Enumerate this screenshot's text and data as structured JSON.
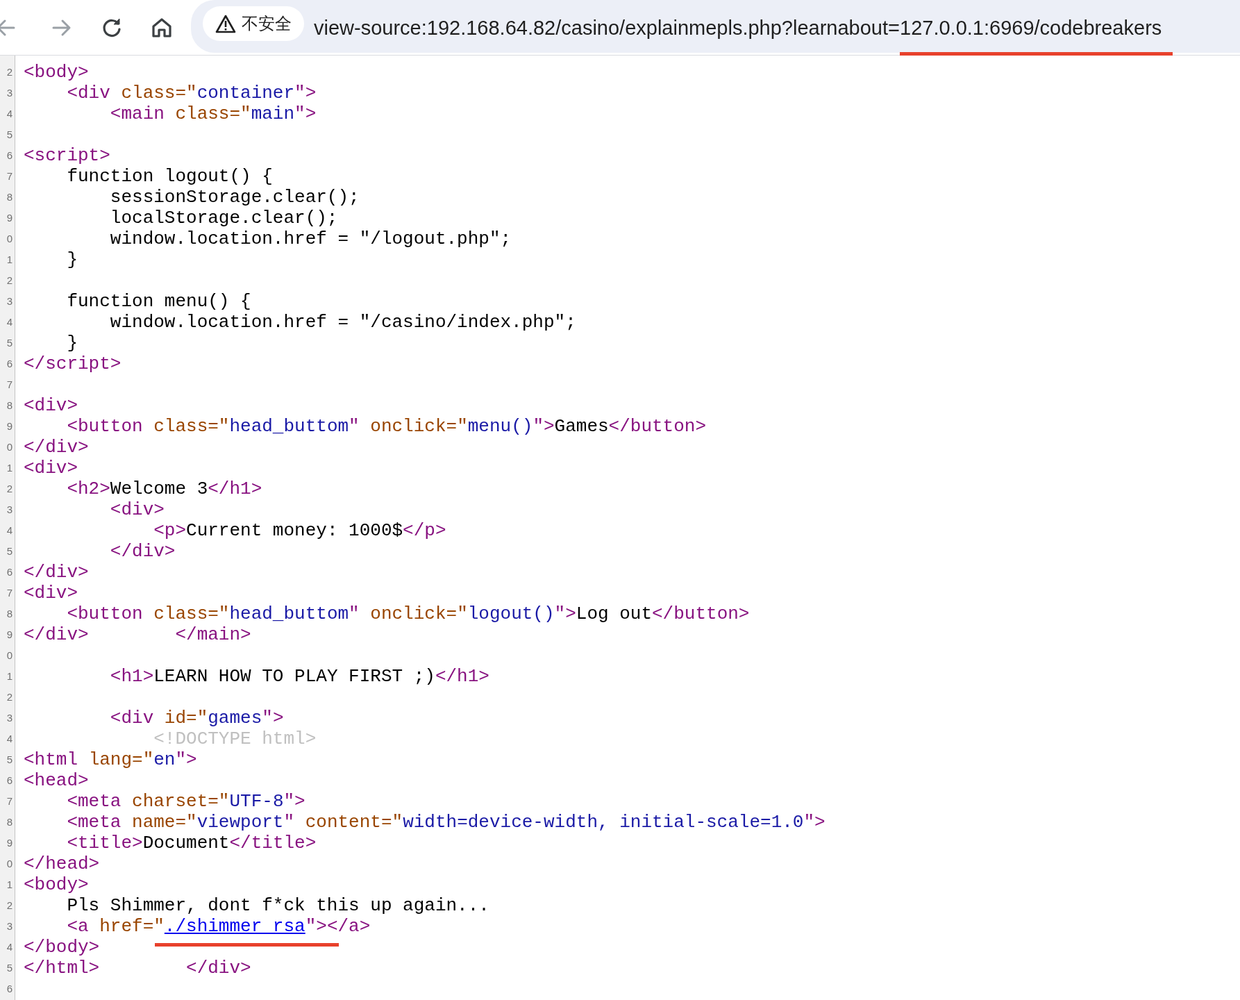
{
  "toolbar": {
    "buttons": [
      {
        "kind": "back",
        "disabled": true
      },
      {
        "kind": "forward",
        "disabled": true
      },
      {
        "kind": "reload",
        "disabled": false
      },
      {
        "kind": "home",
        "disabled": false
      }
    ]
  },
  "address_bar": {
    "security_label": "不安全",
    "url_parts": [
      {
        "text": "view-source:192.168.64.82/casino/explainmepls.php?learnabout=",
        "marked": false
      },
      {
        "text": "127.0.0.1:6969/codebreakers",
        "marked": true
      }
    ]
  },
  "source_lines": [
    {
      "number": "2",
      "tokens": [
        {
          "kind": "tag",
          "t": "<body>"
        }
      ]
    },
    {
      "number": "3",
      "tokens": [
        {
          "kind": "tag",
          "t": "    <div "
        },
        {
          "kind": "attr",
          "t": "class=\""
        },
        {
          "kind": "value",
          "t": "container"
        },
        {
          "kind": "tag",
          "t": "\">"
        }
      ]
    },
    {
      "number": "4",
      "tokens": [
        {
          "kind": "tag",
          "t": "        <main "
        },
        {
          "kind": "attr",
          "t": "class=\""
        },
        {
          "kind": "value",
          "t": "main"
        },
        {
          "kind": "tag",
          "t": "\">"
        }
      ]
    },
    {
      "number": "5"
    },
    {
      "number": "6",
      "tokens": [
        {
          "kind": "tag",
          "t": "<script>"
        }
      ]
    },
    {
      "number": "7",
      "tokens": [
        {
          "kind": "text",
          "t": "    function logout() {"
        }
      ]
    },
    {
      "number": "8",
      "tokens": [
        {
          "kind": "text",
          "t": "        sessionStorage.clear();"
        }
      ]
    },
    {
      "number": "9",
      "tokens": [
        {
          "kind": "text",
          "t": "        localStorage.clear();"
        }
      ]
    },
    {
      "number": "0",
      "tokens": [
        {
          "kind": "text",
          "t": "        window.location.href = \"/logout.php\";"
        }
      ]
    },
    {
      "number": "1",
      "tokens": [
        {
          "kind": "text",
          "t": "    }"
        }
      ]
    },
    {
      "number": "2"
    },
    {
      "number": "3",
      "tokens": [
        {
          "kind": "text",
          "t": "    function menu() {"
        }
      ]
    },
    {
      "number": "4",
      "tokens": [
        {
          "kind": "text",
          "t": "        window.location.href = \"/casino/index.php\";"
        }
      ]
    },
    {
      "number": "5",
      "tokens": [
        {
          "kind": "text",
          "t": "    }"
        }
      ]
    },
    {
      "number": "6",
      "tokens": [
        {
          "kind": "tag",
          "t": "</script>"
        }
      ]
    },
    {
      "number": "7"
    },
    {
      "number": "8",
      "tokens": [
        {
          "kind": "tag",
          "t": "<div>"
        }
      ]
    },
    {
      "number": "9",
      "tokens": [
        {
          "kind": "tag",
          "t": "    <button "
        },
        {
          "kind": "attr",
          "t": "class=\""
        },
        {
          "kind": "value",
          "t": "head_buttom"
        },
        {
          "kind": "tag",
          "t": "\" "
        },
        {
          "kind": "attr",
          "t": "onclick=\""
        },
        {
          "kind": "value",
          "t": "menu()"
        },
        {
          "kind": "tag",
          "t": "\">"
        },
        {
          "kind": "text",
          "t": "Games"
        },
        {
          "kind": "tag",
          "t": "</button>"
        }
      ]
    },
    {
      "number": "0",
      "tokens": [
        {
          "kind": "tag",
          "t": "</div>"
        }
      ]
    },
    {
      "number": "1",
      "tokens": [
        {
          "kind": "tag",
          "t": "<div>"
        }
      ]
    },
    {
      "number": "2",
      "tokens": [
        {
          "kind": "tag",
          "t": "    <h2>"
        },
        {
          "kind": "text",
          "t": "Welcome 3"
        },
        {
          "kind": "tag",
          "t": "</h1>"
        }
      ]
    },
    {
      "number": "3",
      "tokens": [
        {
          "kind": "tag",
          "t": "        <div>"
        }
      ]
    },
    {
      "number": "4",
      "tokens": [
        {
          "kind": "tag",
          "t": "            <p>"
        },
        {
          "kind": "text",
          "t": "Current money: 1000$"
        },
        {
          "kind": "tag",
          "t": "</p>"
        }
      ]
    },
    {
      "number": "5",
      "tokens": [
        {
          "kind": "tag",
          "t": "        </div>"
        }
      ]
    },
    {
      "number": "6",
      "tokens": [
        {
          "kind": "tag",
          "t": "</div>"
        }
      ]
    },
    {
      "number": "7",
      "tokens": [
        {
          "kind": "tag",
          "t": "<div>"
        }
      ]
    },
    {
      "number": "8",
      "tokens": [
        {
          "kind": "tag",
          "t": "    <button "
        },
        {
          "kind": "attr",
          "t": "class=\""
        },
        {
          "kind": "value",
          "t": "head_buttom"
        },
        {
          "kind": "tag",
          "t": "\" "
        },
        {
          "kind": "attr",
          "t": "onclick=\""
        },
        {
          "kind": "value",
          "t": "logout()"
        },
        {
          "kind": "tag",
          "t": "\">"
        },
        {
          "kind": "text",
          "t": "Log out"
        },
        {
          "kind": "tag",
          "t": "</button>"
        }
      ]
    },
    {
      "number": "9",
      "tokens": [
        {
          "kind": "tag",
          "t": "</div>        </main>"
        }
      ]
    },
    {
      "number": "0"
    },
    {
      "number": "1",
      "tokens": [
        {
          "kind": "tag",
          "t": "        <h1>"
        },
        {
          "kind": "text",
          "t": "LEARN HOW TO PLAY FIRST ;)"
        },
        {
          "kind": "tag",
          "t": "</h1>"
        }
      ]
    },
    {
      "number": "2"
    },
    {
      "number": "3",
      "tokens": [
        {
          "kind": "tag",
          "t": "        <div "
        },
        {
          "kind": "attr",
          "t": "id=\""
        },
        {
          "kind": "value",
          "t": "games"
        },
        {
          "kind": "tag",
          "t": "\">"
        }
      ]
    },
    {
      "number": "4",
      "tokens": [
        {
          "kind": "doctype",
          "t": "            <!DOCTYPE html>"
        }
      ]
    },
    {
      "number": "5",
      "tokens": [
        {
          "kind": "tag",
          "t": "<html "
        },
        {
          "kind": "attr",
          "t": "lang=\""
        },
        {
          "kind": "value",
          "t": "en"
        },
        {
          "kind": "tag",
          "t": "\">"
        }
      ]
    },
    {
      "number": "6",
      "tokens": [
        {
          "kind": "tag",
          "t": "<head>"
        }
      ]
    },
    {
      "number": "7",
      "tokens": [
        {
          "kind": "tag",
          "t": "    <meta "
        },
        {
          "kind": "attr",
          "t": "charset=\""
        },
        {
          "kind": "value",
          "t": "UTF-8"
        },
        {
          "kind": "tag",
          "t": "\">"
        }
      ]
    },
    {
      "number": "8",
      "tokens": [
        {
          "kind": "tag",
          "t": "    <meta "
        },
        {
          "kind": "attr",
          "t": "name=\""
        },
        {
          "kind": "value",
          "t": "viewport"
        },
        {
          "kind": "tag",
          "t": "\" "
        },
        {
          "kind": "attr",
          "t": "content=\""
        },
        {
          "kind": "value",
          "t": "width=device-width, initial-scale=1.0"
        },
        {
          "kind": "tag",
          "t": "\">"
        }
      ]
    },
    {
      "number": "9",
      "tokens": [
        {
          "kind": "tag",
          "t": "    <title>"
        },
        {
          "kind": "text",
          "t": "Document"
        },
        {
          "kind": "tag",
          "t": "</title>"
        }
      ]
    },
    {
      "number": "0",
      "tokens": [
        {
          "kind": "tag",
          "t": "</head>"
        }
      ]
    },
    {
      "number": "1",
      "tokens": [
        {
          "kind": "tag",
          "t": "<body>"
        }
      ]
    },
    {
      "number": "2",
      "tokens": [
        {
          "kind": "text",
          "t": "    Pls Shimmer, dont f*ck this up again..."
        }
      ]
    },
    {
      "number": "3",
      "tokens": [
        {
          "kind": "tag",
          "t": "    <a "
        },
        {
          "kind": "attr",
          "t": "href=\""
        },
        {
          "kind": "link",
          "t": "./shimmer_rsa",
          "marked": true
        },
        {
          "kind": "tag",
          "t": "\"></a>"
        }
      ]
    },
    {
      "number": "4",
      "tokens": [
        {
          "kind": "tag",
          "t": "</body>"
        }
      ]
    },
    {
      "number": "5",
      "tokens": [
        {
          "kind": "tag",
          "t": "</html>        </div>"
        }
      ]
    },
    {
      "number": "6"
    }
  ]
}
